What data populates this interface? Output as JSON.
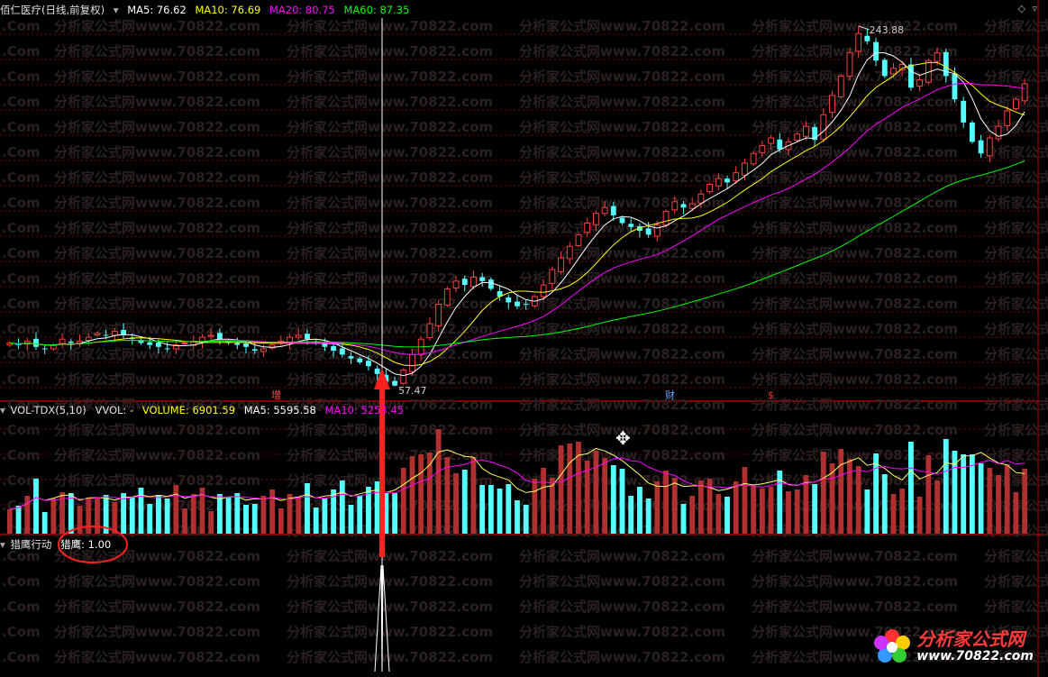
{
  "main_panel": {
    "title": "佰仁医疗(日线,前复权)",
    "ma5": "MA5: 76.62",
    "ma10": "MA10: 76.69",
    "ma20": "MA20: 80.75",
    "ma60": "MA60: 87.35",
    "high_label": "243.88",
    "low_label": "57.47",
    "markers": [
      "增",
      "财",
      "$"
    ]
  },
  "volume_panel": {
    "name": "VOL-TDX(5,10)",
    "vvol": "VVOL: -",
    "volume": "VOLUME: 6901.59",
    "ma5": "MA5: 5595.58",
    "ma10": "MA10: 5253.45"
  },
  "indicator_panel": {
    "name": "猎鹰行动",
    "value": "猎鹰: 1.00"
  },
  "watermark": {
    "text": "分析家公式网www.70822.com",
    "short": ".Com"
  },
  "logo": {
    "main": "分析家公式网",
    "sub": "www.70822.com"
  },
  "colors": {
    "up": "#ff4040",
    "down": "#54ffff",
    "ma5": "#ffffff",
    "ma10": "#ffff00",
    "ma20": "#ff00ff",
    "ma60": "#00ff00",
    "grid": "#7a0000",
    "divider": "#b00000"
  },
  "chart_data": {
    "type": "candlestick",
    "title": "佰仁医疗(日线,前复权)",
    "price_range": [
      57.47,
      243.88
    ],
    "annotated_high": 243.88,
    "annotated_low": 57.47,
    "ma_lines": [
      {
        "name": "MA5",
        "value": 76.62
      },
      {
        "name": "MA10",
        "value": 76.69
      },
      {
        "name": "MA20",
        "value": 80.75
      },
      {
        "name": "MA60",
        "value": 87.35
      }
    ],
    "volume": {
      "VOLUME": 6901.59,
      "MA5": 5595.58,
      "MA10": 5253.45
    },
    "indicator": {
      "name": "猎鹰",
      "value": 1.0
    },
    "close_path": [
      80,
      79,
      81,
      78,
      77,
      79,
      82,
      80,
      81,
      83,
      85,
      84,
      86,
      84,
      82,
      80,
      79,
      78,
      77,
      79,
      80,
      81,
      83,
      84,
      82,
      80,
      79,
      78,
      76,
      77,
      79,
      81,
      83,
      84,
      82,
      80,
      78,
      76,
      74,
      72,
      70,
      68,
      64,
      60,
      58,
      66,
      74,
      82,
      90,
      100,
      108,
      112,
      110,
      114,
      112,
      108,
      104,
      101,
      99,
      100,
      104,
      110,
      118,
      124,
      130,
      136,
      142,
      147,
      150,
      146,
      142,
      140,
      138,
      136,
      141,
      148,
      153,
      150,
      152,
      157,
      162,
      165,
      163,
      168,
      173,
      178,
      182,
      186,
      180,
      184,
      188,
      192,
      185,
      198,
      208,
      218,
      230,
      240,
      236,
      226,
      218,
      222,
      224,
      212,
      216,
      226,
      230,
      218,
      206,
      194,
      184,
      178,
      186,
      192,
      200,
      206,
      214
    ]
  }
}
